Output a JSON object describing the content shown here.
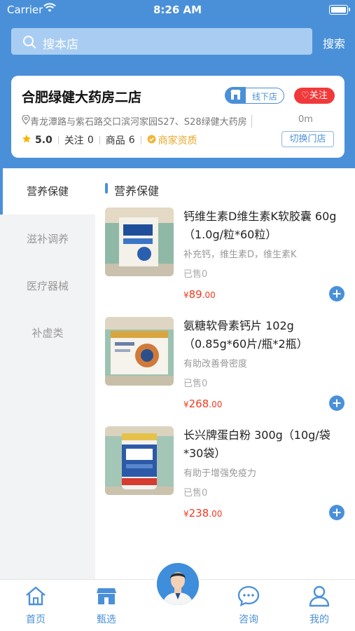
{
  "status_bar": {
    "carrier": "Carrier",
    "time": "8:26 AM"
  },
  "search": {
    "placeholder": "搜本店",
    "button": "搜索"
  },
  "store": {
    "name": "合肥绿健大药房二店",
    "offline_badge": "线下店",
    "follow_button": "关注",
    "address": "青龙潭路与紫石路交口滨河家园S27、S28绿健大药房",
    "distance": "0m",
    "rating": "5.0",
    "follow_label": "关注",
    "follow_count": "0",
    "goods_label": "商品",
    "goods_count": "6",
    "qualification": "商家资质",
    "switch_button": "切换门店"
  },
  "sidebar": {
    "items": [
      {
        "label": "营养保健",
        "active": true
      },
      {
        "label": "滋补调养",
        "active": false
      },
      {
        "label": "医疗器械",
        "active": false
      },
      {
        "label": "补虚类",
        "active": false
      }
    ]
  },
  "section_title": "营养保健",
  "products": [
    {
      "name": "钙维生素D维生素K软胶囊 60g（1.0g/粒*60粒）",
      "desc": "补充钙，维生素D，维生素K",
      "sold": "已售0",
      "price_symbol": "¥",
      "price_int": "89",
      "price_dec": ".00"
    },
    {
      "name": "氨糖软骨素钙片 102g（0.85g*60片/瓶*2瓶）",
      "desc": "有助改善骨密度",
      "sold": "已售0",
      "price_symbol": "¥",
      "price_int": "268",
      "price_dec": ".00"
    },
    {
      "name": "长兴牌蛋白粉 300g（10g/袋*30袋）",
      "desc": "有助于增强免疫力",
      "sold": "已售0",
      "price_symbol": "¥",
      "price_int": "238",
      "price_dec": ".00"
    }
  ],
  "tabbar": {
    "home": "首页",
    "select": "甄选",
    "consult": "咨询",
    "mine": "我的"
  },
  "colors": {
    "primary": "#4a90d9",
    "price": "#f03b1f",
    "follow": "#f0393a",
    "star": "#f5b400"
  }
}
